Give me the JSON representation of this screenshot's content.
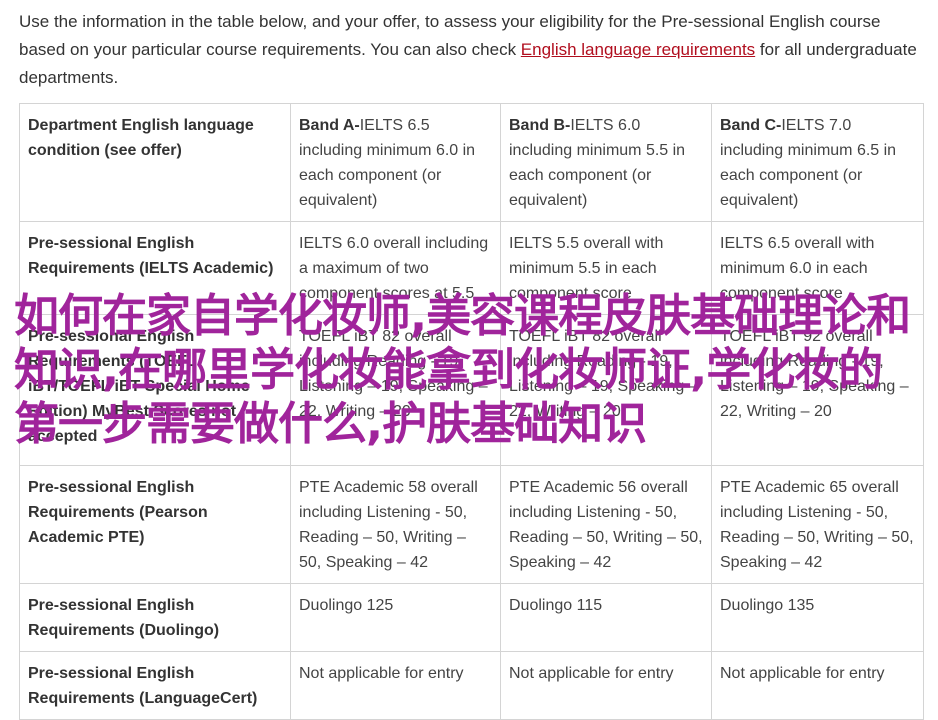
{
  "intro": {
    "before_link": "Use the information in the table below, and your offer, to assess your eligibility for the Pre-sessional English course based on your particular course requirements. You can also check ",
    "link_text": "English language requirements",
    "after_link": " for all undergraduate departments."
  },
  "table": {
    "header": {
      "condition": "Department English language condition (see offer)",
      "bands": [
        {
          "name": "Band A-",
          "text": "IELTS 6.5 including minimum 6.0 in each component (or equivalent)"
        },
        {
          "name": "Band B-",
          "text": "IELTS 6.0 including minimum 5.5 in each component (or equivalent)"
        },
        {
          "name": "Band C-",
          "text": "IELTS 7.0 including minimum 6.5 in each component (or equivalent)"
        }
      ]
    },
    "rows": [
      {
        "label": "Pre-sessional English Requirements (IELTS Academic)",
        "cells": [
          "IELTS 6.0 overall including a maximum of two component scores at 5.5",
          "IELTS 5.5 overall with minimum 5.5 in each component score",
          "IELTS 6.5 overall with minimum 6.0 in each component score"
        ]
      },
      {
        "label": "Pre-sessional English Requirements (TOEFL iBT/TOEFL iBT Special Home Edition) MyBest Scores not accepted",
        "cells": [
          "TOEFL iBT 82 overall including Reading - 19, Listening – 19, Speaking – 22, Writing – 20",
          "TOEFL iBT 82 overall including Reading - 19, Listening – 19, Speaking – 22, Writing – 20",
          "TOEFL iBT 92 overall including Reading - 19, Listening – 19, Speaking – 22, Writing – 20"
        ]
      },
      {
        "label": "Pre-sessional English Requirements (Pearson Academic PTE)",
        "cells": [
          "PTE Academic 58 overall including Listening - 50, Reading – 50, Writing – 50, Speaking – 42",
          "PTE Academic 56 overall including Listening - 50, Reading – 50, Writing – 50, Speaking – 42",
          "PTE Academic 65 overall including Listening - 50, Reading – 50, Writing – 50, Speaking – 42"
        ]
      },
      {
        "label": "Pre-sessional English Requirements (Duolingo)",
        "cells": [
          "Duolingo 125",
          "Duolingo 115",
          "Duolingo 135"
        ]
      },
      {
        "label": "Pre-sessional English Requirements (LanguageCert)",
        "cells": [
          "Not applicable for entry",
          "Not applicable for entry",
          "Not applicable for entry"
        ]
      }
    ]
  },
  "overlay_text": "如何在家自学化妆师,美容课程皮肤基础理论和知识,在哪里学化妆能拿到化妆师证,学化妆的第一步需要做什么,护肤基础知识"
}
